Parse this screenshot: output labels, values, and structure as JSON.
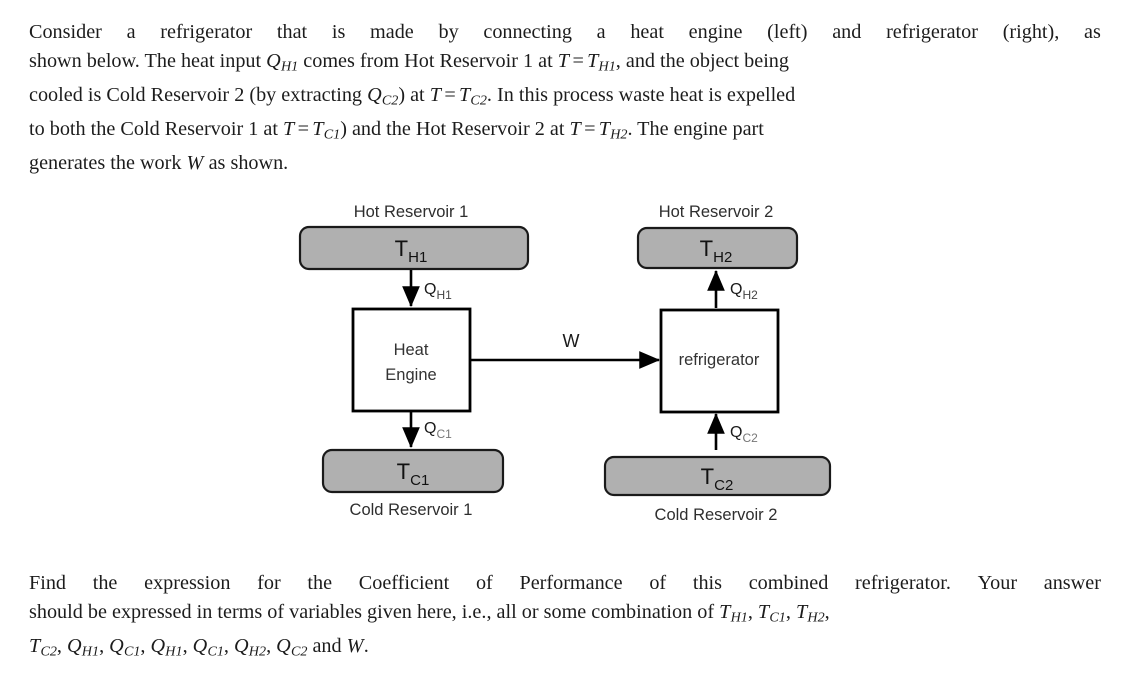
{
  "document": {
    "intro": {
      "lines": [
        "Consider a refrigerator that is made by connecting a heat engine (left) and refrigerator (right), as",
        "shown below. The heat input Q_H1 comes from Hot Reservoir 1 at T = T_H1, and the object being",
        "cooled is Cold Reservoir 2 (by extracting Q_C2) at T = T_C2. In this process waste heat is expelled",
        "to both the Cold Reservoir 1 at T = T_C1) and the Hot Reservoir 2 at T = T_H2. The engine part",
        "generates the work W as shown."
      ],
      "line1_words": [
        "Consider",
        "a",
        "refrigerator",
        "that",
        "is",
        "made",
        "by",
        "connecting",
        "a",
        "heat",
        "engine",
        "(left)",
        "and",
        "refrigerator",
        "(right),",
        "as"
      ],
      "line2_a": "shown below.  The heat input",
      "line2_b": "comes from Hot Reservoir 1 at",
      "line2_c": ", and the object being",
      "line3_a": "cooled is Cold Reservoir 2 (by extracting",
      "line3_b": ") at",
      "line3_c": ".  In this process waste heat is expelled",
      "line4_a": "to both the Cold Reservoir 1 at",
      "line4_b": ") and the Hot Reservoir 2 at",
      "line4_c": ".  The engine part",
      "line5_a": "generates the work",
      "line5_b": "as shown."
    },
    "question": {
      "lines": [
        "Find the expression for the Coefficient of Performance of this combined refrigerator. Your answer",
        "should be expressed in terms of variables given here, i.e., all or some combination of T_H1, T_C1, T_H2,",
        "T_C2, Q_H1, Q_C1, Q_H1, Q_C1, Q_H2, Q_C2 and W."
      ],
      "line1_words": [
        "Find",
        "the",
        "expression",
        "for",
        "the",
        "Coefficient",
        "of",
        "Performance",
        "of",
        "this",
        "combined",
        "refrigerator.",
        "Your",
        "answer"
      ],
      "line2_a": "should be expressed in terms of variables given here, i.e., all or some combination of",
      "line3_and": "and",
      "line3_end": "."
    },
    "math": {
      "Q": "Q",
      "T": "T",
      "W": "W",
      "equals": "=",
      "comma": ",",
      "sub_H1": "H1",
      "sub_H2": "H2",
      "sub_C1": "C1",
      "sub_C2": "C2"
    }
  },
  "diagram": {
    "title_hot_reservoir_1": "Hot Reservoir 1",
    "title_hot_reservoir_2": "Hot Reservoir 2",
    "title_cold_reservoir_1": "Cold Reservoir 1",
    "title_cold_reservoir_2": "Cold Reservoir 2",
    "temp_h1_base": "T",
    "temp_h1_sub": "H1",
    "temp_h2_base": "T",
    "temp_h2_sub": "H2",
    "temp_c1_base": "T",
    "temp_c1_sub": "C1",
    "temp_c2_base": "T",
    "temp_c2_sub": "C2",
    "engine_label_line1": "Heat",
    "engine_label_line2": "Engine",
    "refrigerator_label": "refrigerator",
    "flow_qh1_base": "Q",
    "flow_qh1_sub": "H1",
    "flow_qc1_base": "Q",
    "flow_qc1_sub": "C1",
    "flow_qh2_base": "Q",
    "flow_qh2_sub": "H2",
    "flow_qc2_base": "Q",
    "flow_qc2_sub": "C2",
    "work_label": "W",
    "colors": {
      "reservoir_fill": "#b0b0b0",
      "reservoir_stroke": "#1a1a1a",
      "box_fill": "#ffffff",
      "box_stroke": "#000000",
      "arrow": "#000000",
      "label_text": "#333333",
      "subscript_muted": "#555555",
      "background": "#ffffff"
    }
  }
}
